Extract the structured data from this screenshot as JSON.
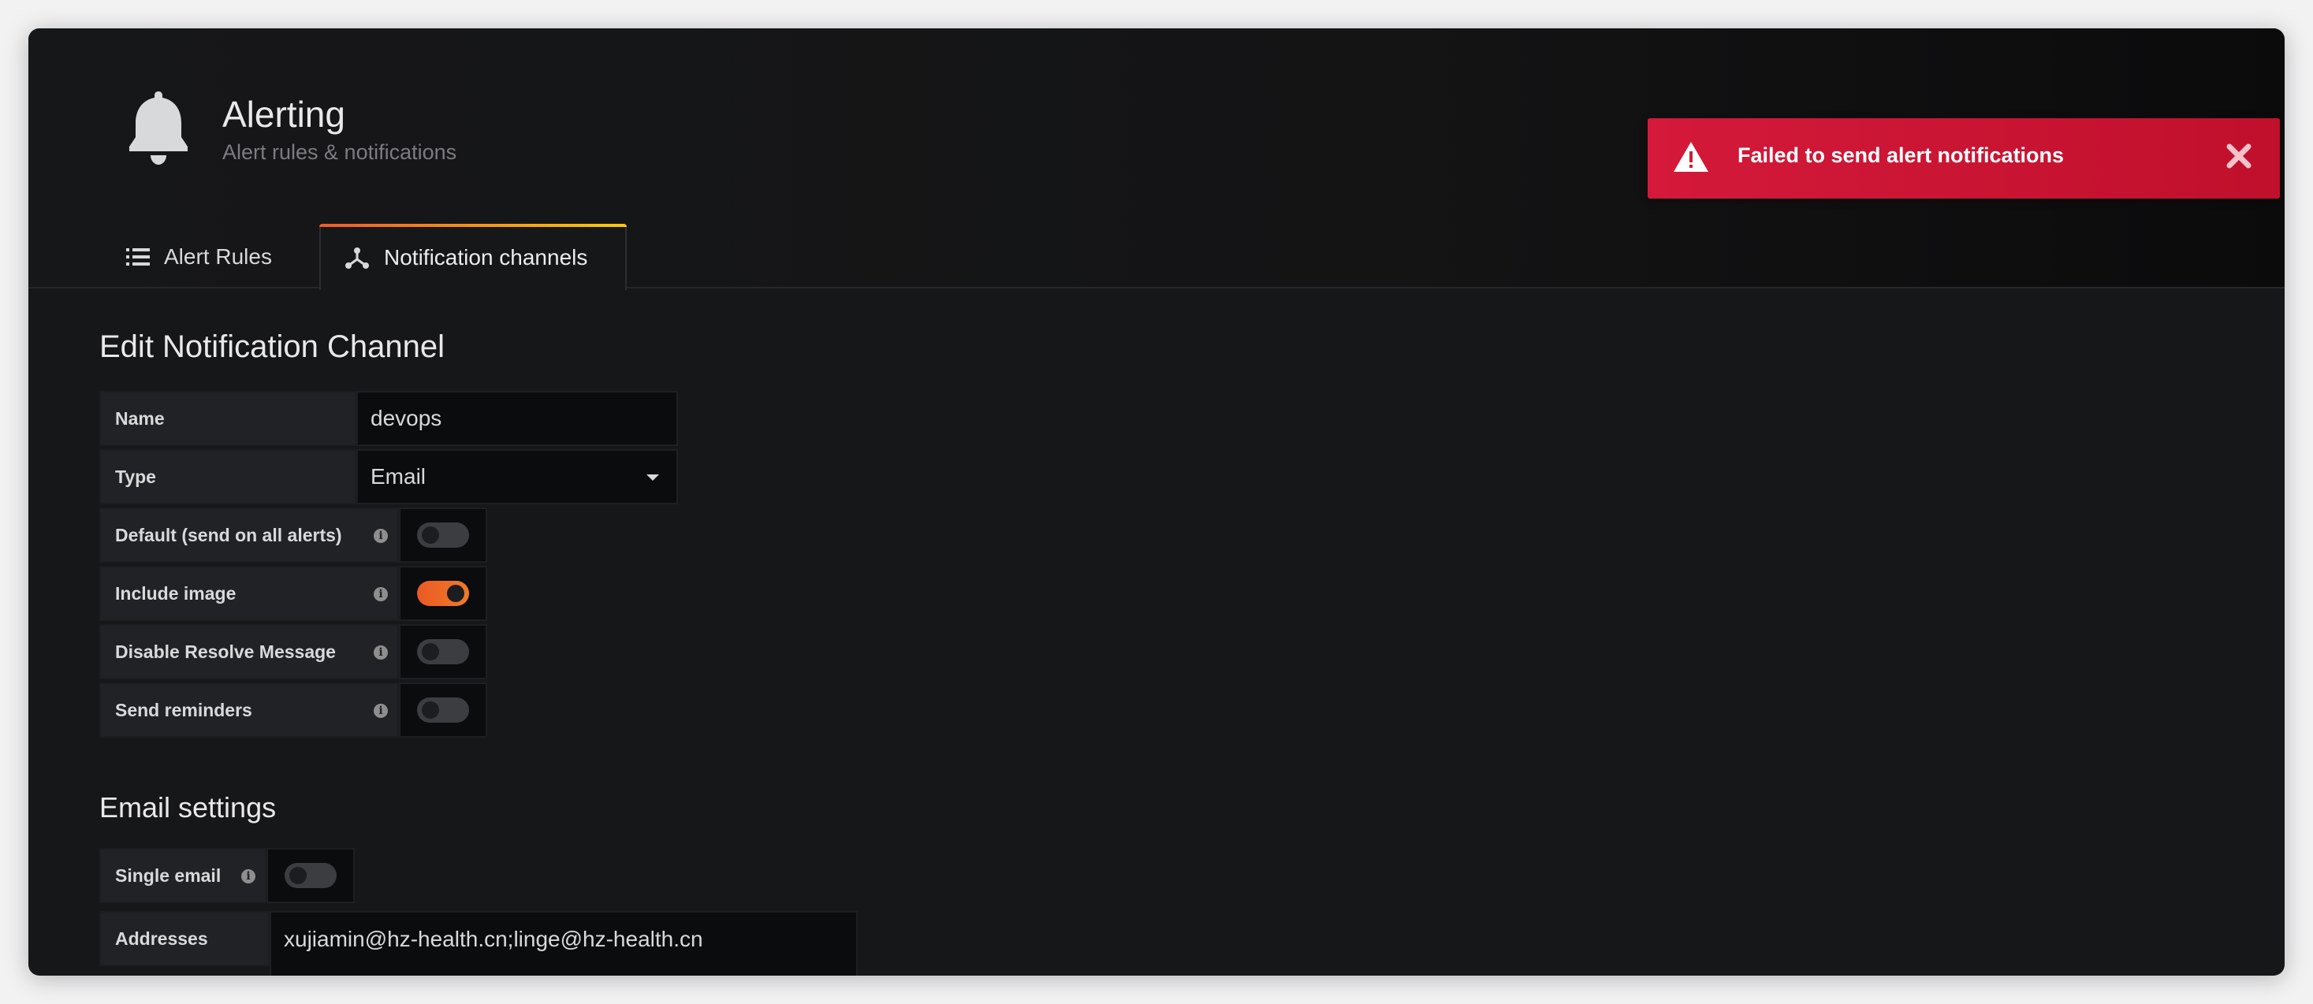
{
  "header": {
    "title": "Alerting",
    "subtitle": "Alert rules & notifications",
    "icon": "bell-icon"
  },
  "tabs": [
    {
      "label": "Alert Rules",
      "icon": "list-icon",
      "active": false
    },
    {
      "label": "Notification channels",
      "icon": "share-nodes-icon",
      "active": true
    }
  ],
  "toast": {
    "message": "Failed to send alert notifications",
    "icon": "warning-triangle-icon",
    "close_icon": "close-icon",
    "color": "#d4193a"
  },
  "form": {
    "title": "Edit Notification Channel",
    "name_label": "Name",
    "name_value": "devops",
    "type_label": "Type",
    "type_value": "Email",
    "toggles": [
      {
        "label": "Default (send on all alerts)",
        "on": false
      },
      {
        "label": "Include image",
        "on": true
      },
      {
        "label": "Disable Resolve Message",
        "on": false
      },
      {
        "label": "Send reminders",
        "on": false
      }
    ]
  },
  "email": {
    "title": "Email settings",
    "single_label": "Single email",
    "single_on": false,
    "addresses_label": "Addresses",
    "addresses_value": "xujiamin@hz-health.cn;linge@hz-health.cn"
  },
  "colors": {
    "accent": "#f05a28",
    "background": "#161719",
    "error": "#d4193a"
  }
}
